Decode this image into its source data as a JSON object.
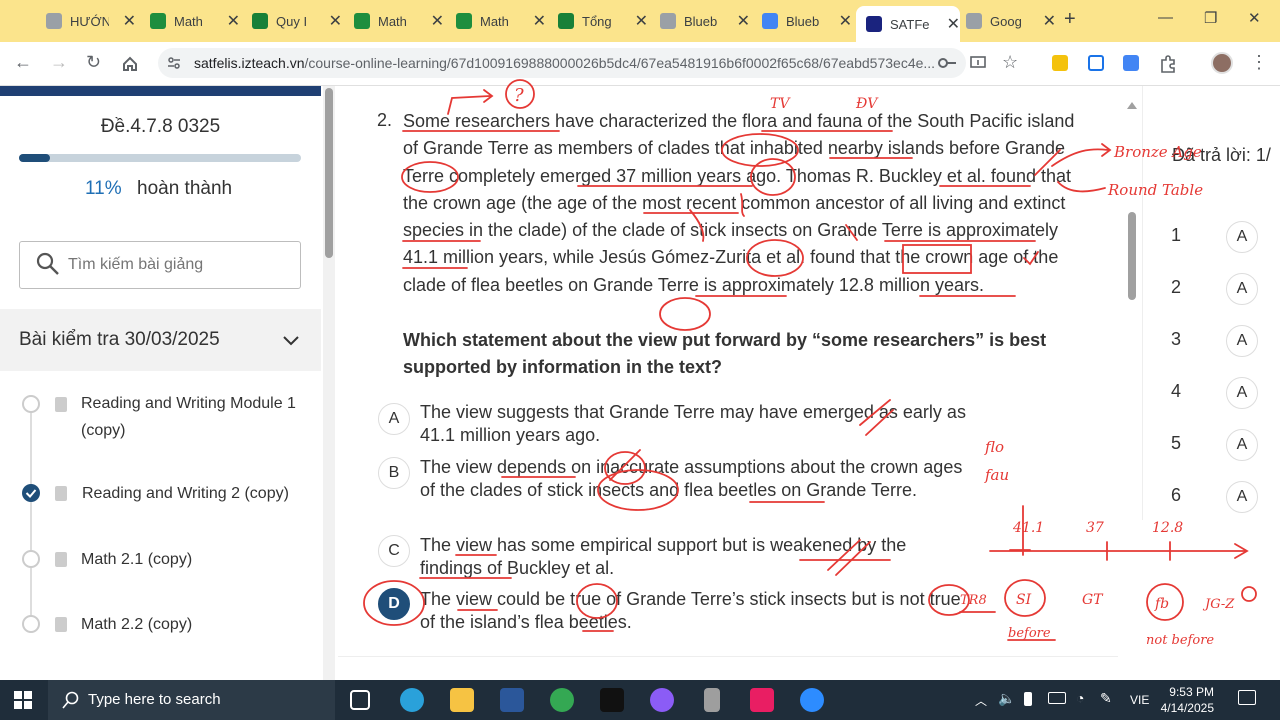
{
  "browser": {
    "tabs": [
      {
        "label": "HƯỚNG",
        "icon": "globe-icon",
        "color": "#9aa0a6"
      },
      {
        "label": "Math",
        "icon": "drive-icon",
        "color": "#1e8e3e"
      },
      {
        "label": "Quy I",
        "icon": "sheets-icon",
        "color": "#188038"
      },
      {
        "label": "Math",
        "icon": "drive-icon",
        "color": "#1e8e3e"
      },
      {
        "label": "Math",
        "icon": "drive-icon",
        "color": "#1e8e3e"
      },
      {
        "label": "Tổng",
        "icon": "sheets-icon",
        "color": "#188038"
      },
      {
        "label": "Blueb",
        "icon": "globe-icon",
        "color": "#9aa0a6"
      },
      {
        "label": "Blueb",
        "icon": "khan-icon",
        "color": "#4285f4"
      },
      {
        "label": "SATFe",
        "icon": "satfelis-icon",
        "color": "#1a237e"
      },
      {
        "label": "Goog",
        "icon": "globe-icon",
        "color": "#9aa0a6"
      }
    ],
    "url_host": "satfelis.izteach.vn",
    "url_path": "/course-online-learning/67d1009169888000026b5dc4/67ea5481916b6f0002f65c68/67eabd573ec4e..."
  },
  "sidebar": {
    "exam_title": "Đề.4.7.8 0325",
    "progress_percent": 11,
    "progress_label": "11%",
    "progress_suffix": "hoàn thành",
    "search_placeholder": "Tìm kiếm bài giảng",
    "section_title": "Bài kiểm tra 30/03/2025",
    "lessons": [
      {
        "label": "Reading and Writing Module 1 (copy)",
        "done": false
      },
      {
        "label": "Reading and Writing 2 (copy)",
        "done": true
      },
      {
        "label": "Math 2.1 (copy)",
        "done": false
      },
      {
        "label": "Math 2.2 (copy)",
        "done": false
      }
    ]
  },
  "question": {
    "number": "2.",
    "passage": "Some researchers have characterized the flora and fauna of the South Pacific island of Grande Terre as members of clades that inhabited nearby islands before Grande Terre completely emerged 37 million years ago. Thomas R. Buckley et al. found that the crown age (the age of the most recent common ancestor of all living and extinct species in the clade) of the clade of stick insects on Grande Terre is approximately 41.1 million years, while Jesús Gómez-Zurita et al. found that the crown age of the clade of flea beetles on Grande Terre is approximately 12.8 million years.",
    "prompt": "Which statement about the view put forward by “some researchers” is best supported by information in the text?",
    "options": [
      {
        "letter": "A",
        "text": "The view suggests that Grande Terre may have emerged as early as 41.1 million years ago.",
        "selected": false
      },
      {
        "letter": "B",
        "text": "The view depends on inaccurate assumptions about the crown ages of the clades of stick insects and flea beetles on Grande Terre.",
        "selected": false
      },
      {
        "letter": "C",
        "text": "The view has some empirical support but is weakened by the findings of Buckley et al.",
        "selected": false
      },
      {
        "letter": "D",
        "text": "The view could be true of Grande Terre’s stick insects but is not true of the island’s flea beetles.",
        "selected": true
      }
    ]
  },
  "answers": {
    "header": "Đã trả lời: 1/",
    "rows": [
      {
        "num": "1",
        "ans": "A"
      },
      {
        "num": "2",
        "ans": "A"
      },
      {
        "num": "3",
        "ans": "A"
      },
      {
        "num": "4",
        "ans": "A"
      },
      {
        "num": "5",
        "ans": "A"
      },
      {
        "num": "6",
        "ans": "A"
      }
    ]
  },
  "annotations": {
    "ink_color": "#e53935",
    "texts": [
      "?",
      "TV",
      "ĐV",
      "Bronze Age",
      "Round Table",
      "flo",
      "fau",
      "41.1",
      "37",
      "12.8",
      "GT",
      "TR8",
      "SI",
      "before",
      "fb",
      "JG-Z",
      "not before"
    ]
  },
  "taskbar": {
    "search_placeholder": "Type here to search",
    "language": "VIE",
    "time": "9:53 PM",
    "date": "4/14/2025"
  }
}
